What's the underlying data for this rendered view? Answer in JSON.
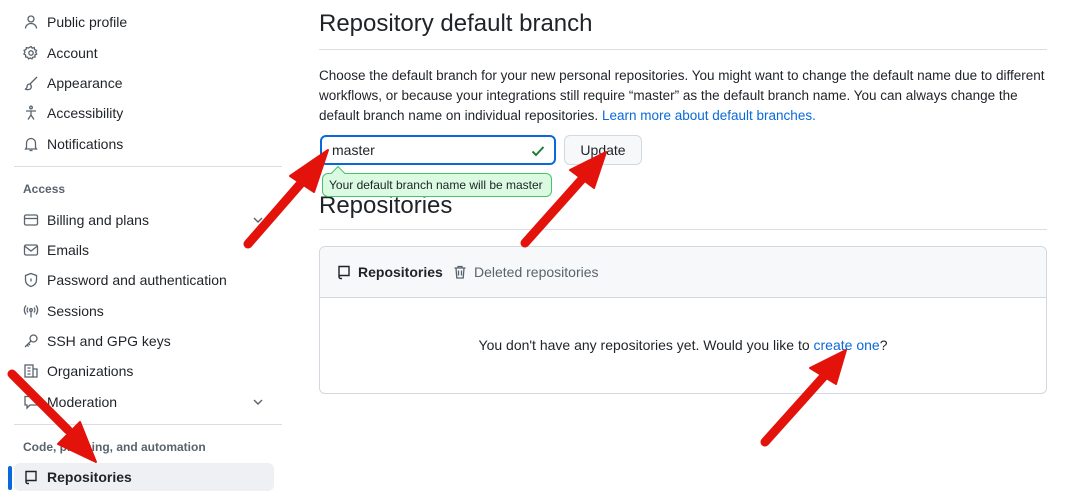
{
  "sidebar": {
    "items_top": [
      {
        "label": "Public profile",
        "icon": "person-icon"
      },
      {
        "label": "Account",
        "icon": "gear-icon"
      },
      {
        "label": "Appearance",
        "icon": "paintbrush-icon"
      },
      {
        "label": "Accessibility",
        "icon": "accessibility-icon"
      },
      {
        "label": "Notifications",
        "icon": "bell-icon"
      }
    ],
    "access_title": "Access",
    "items_access": [
      {
        "label": "Billing and plans",
        "icon": "credit-card-icon"
      },
      {
        "label": "Emails",
        "icon": "mail-icon"
      },
      {
        "label": "Password and authentication",
        "icon": "shield-lock-icon"
      },
      {
        "label": "Sessions",
        "icon": "broadcast-icon"
      },
      {
        "label": "SSH and GPG keys",
        "icon": "key-icon"
      },
      {
        "label": "Organizations",
        "icon": "organization-icon"
      },
      {
        "label": "Moderation",
        "icon": "report-icon"
      }
    ],
    "code_title": "Code, planning, and automation",
    "active_item": {
      "label": "Repositories",
      "icon": "repo-icon"
    }
  },
  "main": {
    "title": "Repository default branch",
    "description": "Choose the default branch for your new personal repositories. You might want to change the default name due to different workflows, or because your integrations still require “master” as the default branch name. You can always change the default branch name on individual repositories.",
    "learn_more_link": "Learn more about default branches.",
    "branch_input_value": "master",
    "update_button": "Update",
    "validation_message": "Your default branch name will be master",
    "repos_title": "Repositories",
    "tabs": [
      {
        "label": "Repositories",
        "icon": "repo-icon",
        "selected": true
      },
      {
        "label": "Deleted repositories",
        "icon": "trash-icon",
        "selected": false
      }
    ],
    "empty_text": "You don't have any repositories yet. Would you like to ",
    "create_link": "create one",
    "empty_suffix": "?"
  },
  "colors": {
    "accent": "#0969da",
    "success": "#1a7f37",
    "annotation": "#e3120b"
  }
}
